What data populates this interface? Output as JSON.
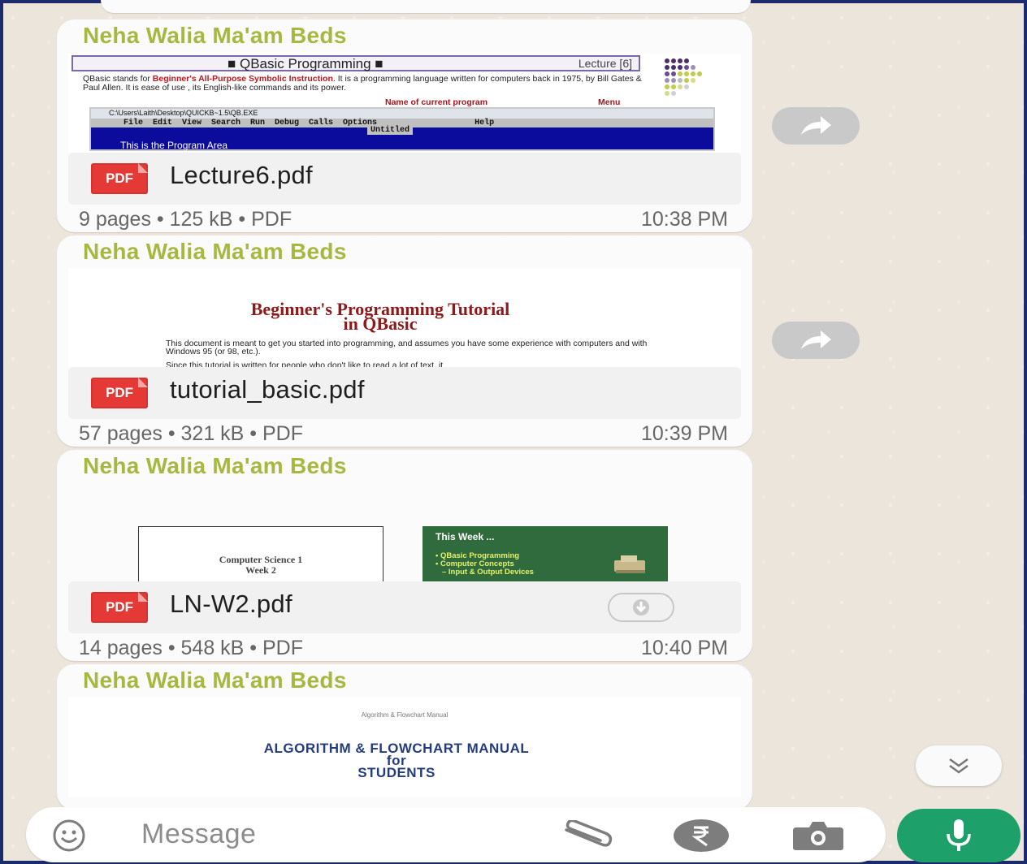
{
  "messages": [
    {
      "sender": "Neha Walia Ma'am Beds",
      "file_name": "Lecture6.pdf",
      "file_type": "PDF",
      "meta": "9 pages • 125 kB • PDF",
      "time": "10:38 PM",
      "preview": {
        "title": "■ QBasic Programming ■",
        "lecture": "Lecture [6]",
        "text_a": "QBasic stands for ",
        "text_b": "Beginner's All-Purpose Symbolic Instruction",
        "text_c": ". It is a programming language written for computers back in 1975, by Bill Gates & Paul Allen. It is ease of use , its English-like commands and its power.",
        "annot_name": "Name of current program",
        "annot_menu": "Menu",
        "window_title": "C:\\Users\\Laith\\Desktop\\QUICKB~1.5\\QB.EXE",
        "menu": "File  Edit  View  Search  Run  Debug  Calls  Options                    Help",
        "untitled": "Untitled",
        "area_text": "This is the Program Area"
      }
    },
    {
      "sender": "Neha Walia Ma'am Beds",
      "file_name": "tutorial_basic.pdf",
      "file_type": "PDF",
      "meta": "57 pages • 321 kB • PDF",
      "time": "10:39 PM",
      "preview": {
        "title_line1": "Beginner's Programming Tutorial",
        "title_line2": "in QBasic",
        "body1": "This document is meant to get you started into programming, and assumes you have some experience with computers and with Windows 95 (or 98, etc.).",
        "body2": "Since this tutorial is written for people who don't like to read a lot of text, it"
      }
    },
    {
      "sender": "Neha Walia Ma'am Beds",
      "file_name": "LN-W2.pdf",
      "file_type": "PDF",
      "meta": "14 pages • 548 kB • PDF",
      "time": "10:40 PM",
      "preview": {
        "slide1_line1": "Computer Science 1",
        "slide1_line2": "Week 2",
        "slide2_title": "This Week ...",
        "slide2_item1": "• QBasic Programming",
        "slide2_item2": "• Computer Concepts",
        "slide2_item3": "– Input & Output Devices"
      }
    },
    {
      "sender": "Neha Walia Ma'am Beds",
      "preview": {
        "small": "Algorithm & Flowchart Manual",
        "line1": "ALGORITHM & FLOWCHART MANUAL",
        "line2": "for",
        "line3": "STUDENTS"
      }
    }
  ],
  "input": {
    "placeholder": "Message"
  },
  "icons": {
    "emoji": "emoji-icon",
    "attach": "paperclip-icon",
    "payment": "rupee-icon",
    "camera": "camera-icon",
    "mic": "microphone-icon",
    "forward": "forward-arrow-icon",
    "download": "download-icon",
    "scroll": "double-chevron-down-icon"
  },
  "colors": {
    "sender": "#a7b841",
    "pdf_badge": "#e53935",
    "mic_button": "#1ea06a"
  }
}
